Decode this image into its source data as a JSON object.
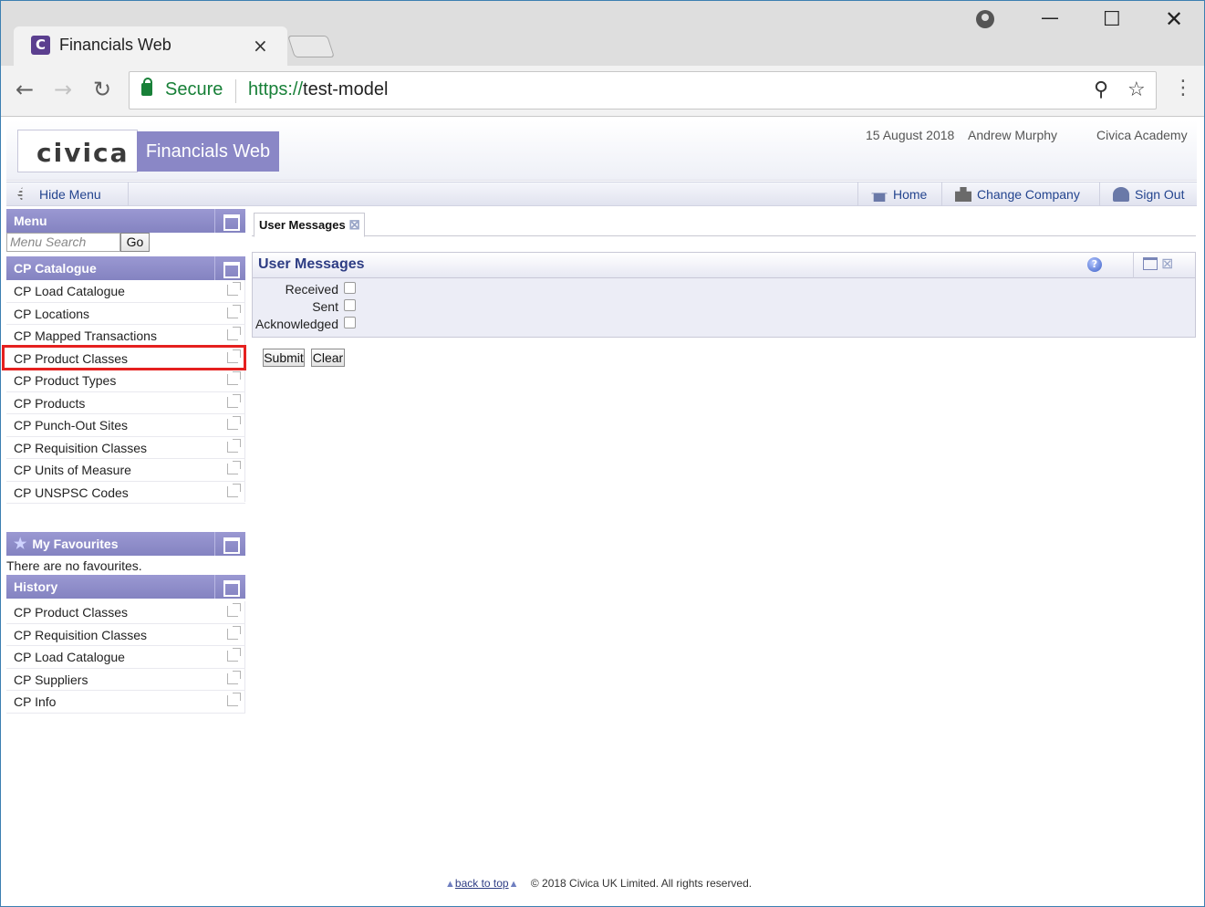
{
  "browser": {
    "tab_title": "Financials Web",
    "tab_close": "×",
    "favicon_letter": "C",
    "secure_label": "Secure",
    "url_scheme": "https://",
    "url_host": "test-model"
  },
  "header": {
    "logo_text": "civica",
    "app_name": "Financials Web",
    "date": "15 August 2018",
    "user": "Andrew Murphy",
    "company": "Civica Academy"
  },
  "strip": {
    "hide_menu": "Hide Menu",
    "home": "Home",
    "change_company": "Change Company",
    "sign_out": "Sign Out"
  },
  "menu": {
    "title": "Menu",
    "search_placeholder": "Menu Search",
    "go_label": "Go"
  },
  "catalogue": {
    "title": "CP Catalogue",
    "items": [
      "CP Load Catalogue",
      "CP Locations",
      "CP Mapped Transactions",
      "CP Product Classes",
      "CP Product Types",
      "CP Products",
      "CP Punch-Out Sites",
      "CP Requisition Classes",
      "CP Units of Measure",
      "CP UNSPSC Codes"
    ]
  },
  "favourites": {
    "title": "My Favourites",
    "empty_text": "There are no favourites."
  },
  "history": {
    "title": "History",
    "items": [
      "CP Product Classes",
      "CP Requisition Classes",
      "CP Load Catalogue",
      "CP Suppliers",
      "CP Info"
    ]
  },
  "main": {
    "tab_label": "User Messages",
    "section_title": "User Messages",
    "checkboxes": [
      "Received",
      "Sent",
      "Acknowledged"
    ],
    "submit_label": "Submit",
    "clear_label": "Clear"
  },
  "footer": {
    "back_to_top": "back to top",
    "copyright": "© 2018 Civica UK Limited. All rights reserved."
  },
  "colors": {
    "accent": "#8483c1",
    "link": "#24458f",
    "highlight": "#e5201f",
    "secure": "#188038"
  }
}
